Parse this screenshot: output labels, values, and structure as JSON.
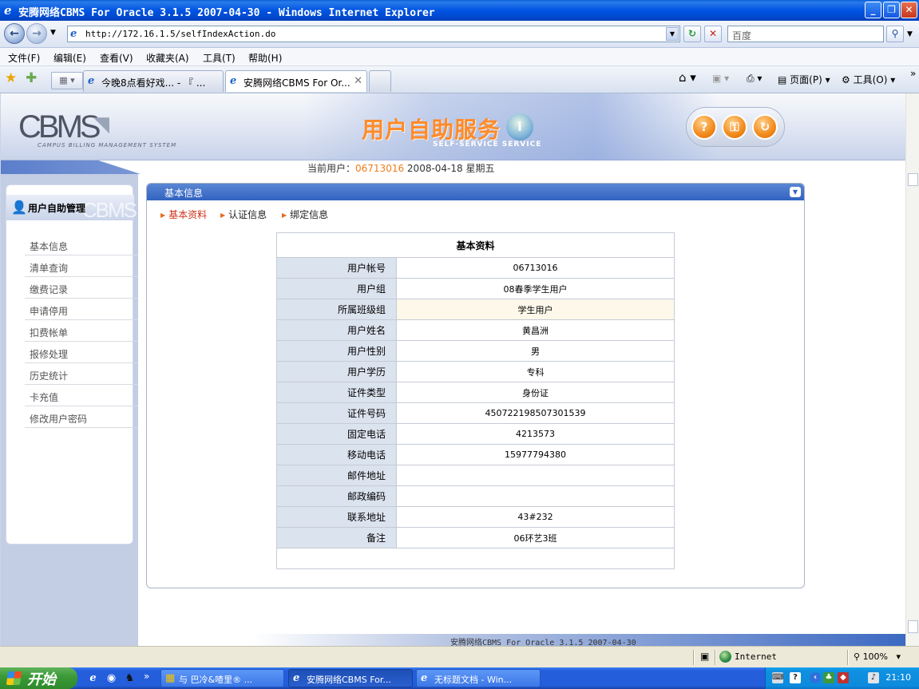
{
  "window": {
    "title": "安腾网络CBMS For Oracle 3.1.5 2007-04-30 - Windows Internet Explorer",
    "min": "_",
    "max": "❐",
    "close": "✕"
  },
  "address": {
    "url": "http://172.16.1.5/selfIndexAction.do",
    "search_placeholder": "百度"
  },
  "menu": [
    "文件(F)",
    "编辑(E)",
    "查看(V)",
    "收藏夹(A)",
    "工具(T)",
    "帮助(H)"
  ],
  "tabs": [
    {
      "label": "今晚8点看好戏... - 『 ..."
    },
    {
      "label": "安腾网络CBMS For Or..."
    }
  ],
  "command_bar": {
    "page": "页面(P)",
    "tools": "工具(O)"
  },
  "header": {
    "logo": "CBMS",
    "logo_sub": "CAMPUS BILLING MANAGEMENT SYSTEM",
    "title": "用户自助服务",
    "subtitle": "SELF-SERVICE SERVICE",
    "buttons": [
      "?",
      "⚿",
      "↻"
    ]
  },
  "current_user": {
    "label": "当前用户：",
    "id": "06713016",
    "date": "2008-04-18 星期五"
  },
  "sidebar": {
    "title": "用户自助管理",
    "watermark": "CBMS",
    "items": [
      "基本信息",
      "清单查询",
      "缴费记录",
      "申请停用",
      "扣费帐单",
      "报修处理",
      "历史统计",
      "卡充值",
      "修改用户密码"
    ]
  },
  "panel": {
    "title": "基本信息",
    "tabs": [
      "基本资料",
      "认证信息",
      "绑定信息"
    ]
  },
  "info_table": {
    "title": "基本资料",
    "rows": [
      {
        "k": "用户帐号",
        "v": "06713016"
      },
      {
        "k": "用户组",
        "v": "08春季学生用户"
      },
      {
        "k": "所属班级组",
        "v": "学生用户"
      },
      {
        "k": "用户姓名",
        "v": "黄昌洲"
      },
      {
        "k": "用户性别",
        "v": "男"
      },
      {
        "k": "用户学历",
        "v": "专科"
      },
      {
        "k": "证件类型",
        "v": "身份证"
      },
      {
        "k": "证件号码",
        "v": "450722198507301539"
      },
      {
        "k": "固定电话",
        "v": "4213573"
      },
      {
        "k": "移动电话",
        "v": "15977794380"
      },
      {
        "k": "邮件地址",
        "v": ""
      },
      {
        "k": "邮政编码",
        "v": ""
      },
      {
        "k": "联系地址",
        "v": "43#232"
      },
      {
        "k": "备注",
        "v": "06环艺3班"
      }
    ]
  },
  "footer": "安腾网络CBMS For Oracle 3.1.5 2007-04-30",
  "status": {
    "zone": "Internet",
    "zoom": "100%"
  },
  "taskbar": {
    "start": "开始",
    "tasks": [
      "与 巴冷&喳里® ...",
      "安腾网络CBMS For...",
      "无标题文档 - Win..."
    ],
    "clock": "21:10"
  }
}
